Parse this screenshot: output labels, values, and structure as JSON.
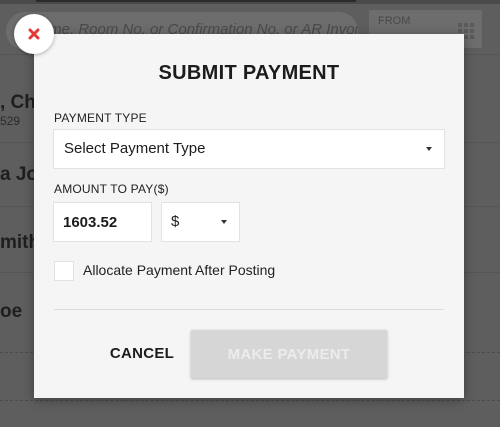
{
  "background": {
    "search_placeholder": "Name, Room No. or Confirmation No. or AR Invoice No.",
    "search_visible": "Na      oom No. or Confirmation No. or AR Invoice No.",
    "date_from_label": "FROM",
    "rows": [
      {
        "name": ", Chr",
        "sub": "529"
      },
      {
        "name": "a Jor",
        "sub": ""
      },
      {
        "name": "mith",
        "sub": ""
      },
      {
        "name": "oe",
        "sub": ""
      }
    ]
  },
  "modal": {
    "title": "SUBMIT PAYMENT",
    "payment_type_label": "PAYMENT TYPE",
    "payment_type_value": "Select Payment Type",
    "amount_label": "AMOUNT TO PAY($)",
    "amount_value": "1603.52",
    "currency_value": "$",
    "allocate_label": "Allocate Payment After Posting",
    "allocate_checked": false,
    "cancel_label": "CANCEL",
    "pay_label": "MAKE PAYMENT"
  },
  "colors": {
    "close_icon": "#e53935",
    "pay_button_disabled_bg": "#d6d6d6",
    "pay_button_disabled_text": "#ececec",
    "overlay": "#5e5e5e"
  },
  "icons": {
    "close": "close-icon",
    "calendar": "calendar-icon",
    "dropdown": "chevron-down-icon"
  }
}
